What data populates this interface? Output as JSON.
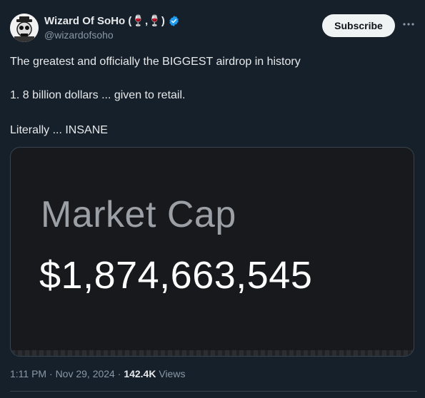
{
  "author": {
    "display_name": "Wizard Of SoHo (🍷,🍷)",
    "handle": "@wizardofsoho",
    "avatar_icon": "skull-avatar-icon"
  },
  "actions": {
    "subscribe_label": "Subscribe",
    "more_icon": "more-horizontal-icon"
  },
  "tweet": {
    "paragraphs": [
      "The greatest and officially the BIGGEST airdrop in history",
      "1. 8 billion dollars ... given to retail.",
      "Literally ... INSANE"
    ]
  },
  "media": {
    "label": "Market Cap",
    "value": "$1,874,663,545"
  },
  "meta": {
    "time": "1:11 PM",
    "date": "Nov 29, 2024",
    "views_count": "142.4K",
    "views_label": "Views"
  },
  "colors": {
    "background": "#15202b",
    "verified_blue": "#1d9bf0",
    "subscribe_bg": "#eff3f4"
  }
}
